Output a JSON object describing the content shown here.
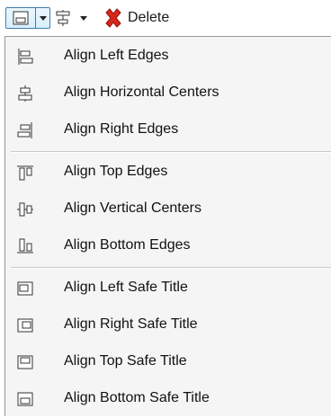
{
  "toolbar": {
    "align_dropdown": {
      "icon": "align-icon",
      "arrow": "dropdown-arrow-icon"
    },
    "arrange_dropdown": {
      "icon": "distribute-icon",
      "arrow": "dropdown-arrow-icon"
    },
    "delete_label": "Delete",
    "delete_icon_color": "#d9261c"
  },
  "menu": {
    "groups": [
      [
        {
          "label": "Align Left Edges",
          "icon": "align-left-edges-icon"
        },
        {
          "label": "Align Horizontal Centers",
          "icon": "align-horizontal-centers-icon"
        },
        {
          "label": "Align Right Edges",
          "icon": "align-right-edges-icon"
        }
      ],
      [
        {
          "label": "Align Top Edges",
          "icon": "align-top-edges-icon"
        },
        {
          "label": "Align Vertical Centers",
          "icon": "align-vertical-centers-icon"
        },
        {
          "label": "Align Bottom Edges",
          "icon": "align-bottom-edges-icon"
        }
      ],
      [
        {
          "label": "Align Left Safe Title",
          "icon": "align-left-safe-title-icon"
        },
        {
          "label": "Align Right Safe Title",
          "icon": "align-right-safe-title-icon"
        },
        {
          "label": "Align Top Safe Title",
          "icon": "align-top-safe-title-icon"
        },
        {
          "label": "Align Bottom Safe Title",
          "icon": "align-bottom-safe-title-icon"
        }
      ]
    ]
  }
}
